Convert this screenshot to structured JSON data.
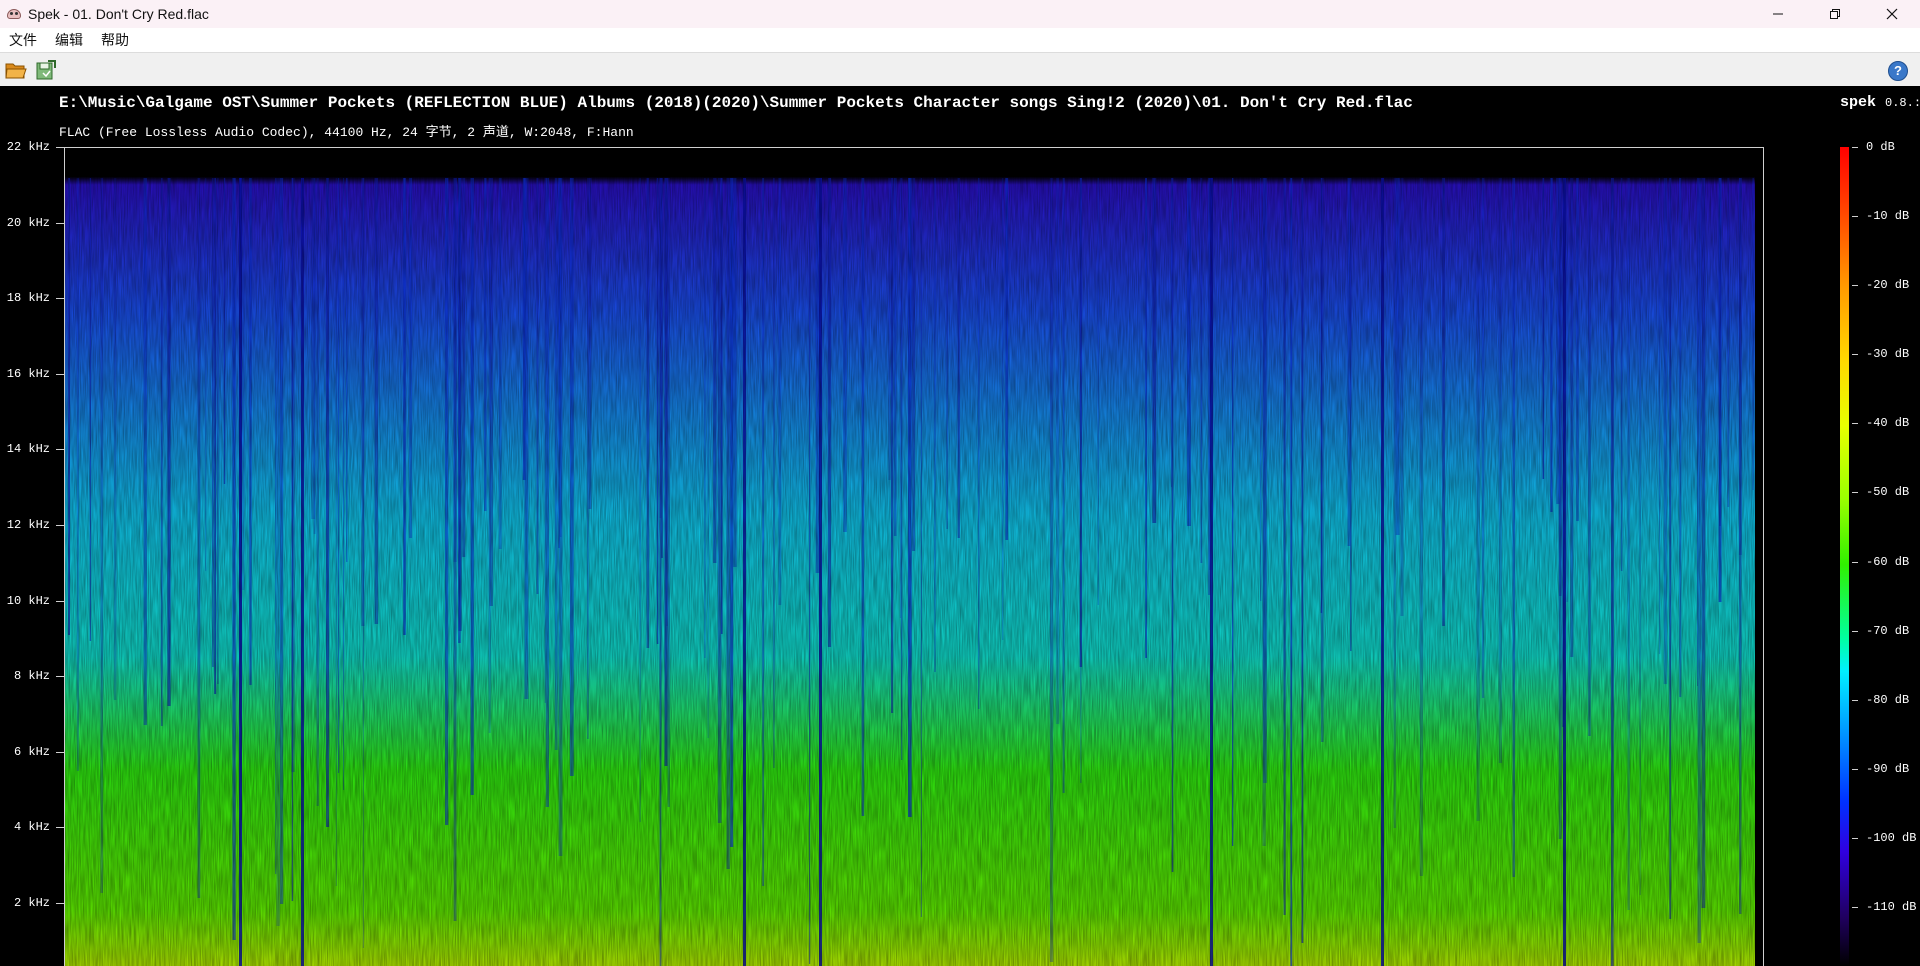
{
  "window": {
    "title": "Spek - 01. Don't Cry Red.flac",
    "app_icon": "spek-icon",
    "controls": [
      "minimize-icon",
      "restore-icon",
      "close-icon"
    ]
  },
  "menu": {
    "items": [
      "文件",
      "编辑",
      "帮助"
    ]
  },
  "toolbar": {
    "buttons": [
      "open-folder-icon",
      "save-icon"
    ],
    "help_label": "?"
  },
  "spectrogram": {
    "file_path": "E:\\Music\\Galgame OST\\Summer Pockets (REFLECTION BLUE) Albums (2018)(2020)\\Summer Pockets Character songs Sing!2 (2020)\\01. Don't Cry Red.flac",
    "file_info": "FLAC (Free Lossless Audio Codec), 44100 Hz, 24 字节, 2 声道, W:2048, F:Hann",
    "app_name": "spek",
    "app_version": "0.8.:",
    "freq_labels": [
      "22 kHz",
      "20 kHz",
      "18 kHz",
      "16 kHz",
      "14 kHz",
      "12 kHz",
      "10 kHz",
      "8 kHz",
      "6 kHz",
      "4 kHz",
      "2 kHz"
    ],
    "db_labels": [
      "0 dB",
      "-10 dB",
      "-20 dB",
      "-30 dB",
      "-40 dB",
      "-50 dB",
      "-60 dB",
      "-70 dB",
      "-80 dB",
      "-90 dB",
      "-100 dB",
      "-110 dB"
    ],
    "colors": {
      "background": "#000000",
      "top": "#2a10c8",
      "high": "#1a50f0",
      "mid": "#10c8f0",
      "low": "#20e020",
      "bottom": "#b8f000"
    }
  }
}
